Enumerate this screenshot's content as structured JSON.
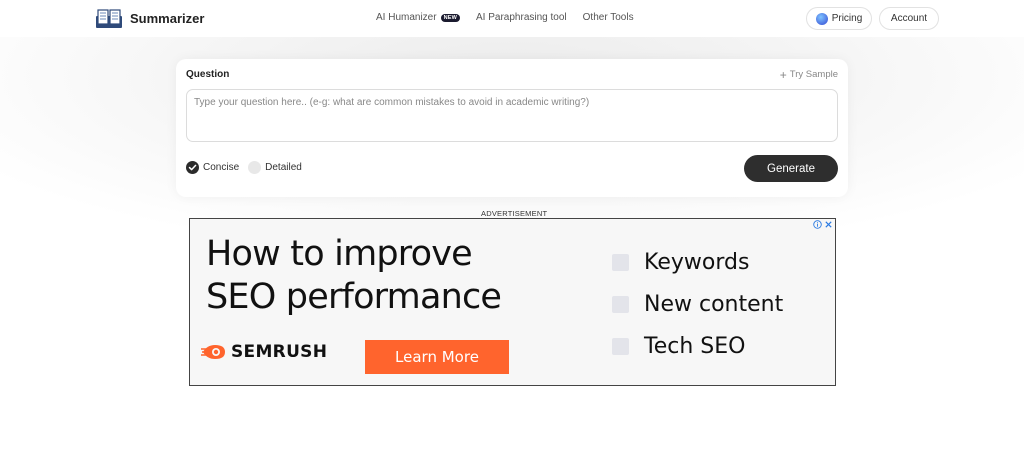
{
  "header": {
    "brand": "Summarizer",
    "nav": [
      {
        "label": "AI Humanizer",
        "badge": "NEW"
      },
      {
        "label": "AI Paraphrasing tool"
      },
      {
        "label": "Other Tools"
      }
    ],
    "pricing_label": "Pricing",
    "account_label": "Account"
  },
  "question_card": {
    "label": "Question",
    "try_sample": "Try Sample",
    "placeholder": "Type your question here.. (e-g: what are common mistakes to avoid in academic writing?)",
    "value": "",
    "modes": [
      {
        "label": "Concise",
        "checked": true
      },
      {
        "label": "Detailed",
        "checked": false
      }
    ],
    "generate_label": "Generate"
  },
  "advertisement": {
    "label": "ADVERTISEMENT",
    "headline_line1": "How to improve",
    "headline_line2": "SEO performance",
    "brand": "SEMRUSH",
    "cta": "Learn More",
    "checklist": [
      "Keywords",
      "New content",
      "Tech SEO"
    ],
    "cta_color": "#ff642d"
  }
}
